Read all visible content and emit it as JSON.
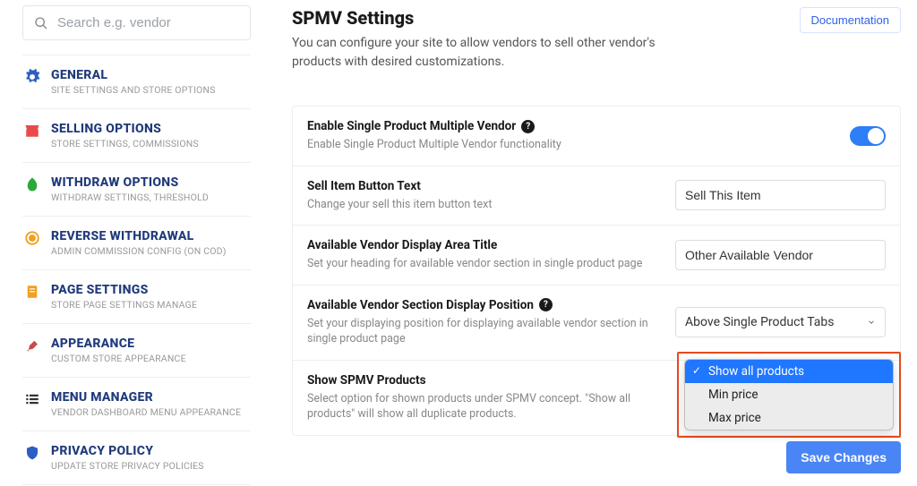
{
  "search": {
    "placeholder": "Search e.g. vendor"
  },
  "sidebar": {
    "items": [
      {
        "title": "GENERAL",
        "sub": "SITE SETTINGS AND STORE OPTIONS",
        "icon": "gear",
        "color": "#2b5fc1"
      },
      {
        "title": "SELLING OPTIONS",
        "sub": "STORE SETTINGS, COMMISSIONS",
        "icon": "store",
        "color": "#e94b4b"
      },
      {
        "title": "WITHDRAW OPTIONS",
        "sub": "WITHDRAW SETTINGS, THRESHOLD",
        "icon": "leaf",
        "color": "#2aa83a"
      },
      {
        "title": "REVERSE WITHDRAWAL",
        "sub": "ADMIN COMMISSION CONFIG (ON COD)",
        "icon": "coin",
        "color": "#f0a020"
      },
      {
        "title": "PAGE SETTINGS",
        "sub": "STORE PAGE SETTINGS MANAGE",
        "icon": "page",
        "color": "#f0a020"
      },
      {
        "title": "APPEARANCE",
        "sub": "CUSTOM STORE APPEARANCE",
        "icon": "palette",
        "color": "#c84b4b"
      },
      {
        "title": "MENU MANAGER",
        "sub": "VENDOR DASHBOARD MENU APPEARANCE",
        "icon": "menu",
        "color": "#333333"
      },
      {
        "title": "PRIVACY POLICY",
        "sub": "UPDATE STORE PRIVACY POLICIES",
        "icon": "shield",
        "color": "#2b5fc1"
      }
    ]
  },
  "header": {
    "title": "SPMV Settings",
    "desc": "You can configure your site to allow vendors to sell other vendor's products with desired customizations.",
    "doc_label": "Documentation"
  },
  "rows": {
    "enable": {
      "title": "Enable Single Product Multiple Vendor",
      "desc": "Enable Single Product Multiple Vendor functionality",
      "toggle": true
    },
    "button_text": {
      "title": "Sell Item Button Text",
      "desc": "Change your sell this item button text",
      "value": "Sell This Item"
    },
    "area_title": {
      "title": "Available Vendor Display Area Title",
      "desc": "Set your heading for available vendor section in single product page",
      "value": "Other Available Vendor"
    },
    "position": {
      "title": "Available Vendor Section Display Position",
      "desc": "Set your displaying position for displaying available vendor section in single product page",
      "value": "Above Single Product Tabs"
    },
    "show": {
      "title": "Show SPMV Products",
      "desc": "Select option for shown products under SPMV concept. \"Show all products\" will show all duplicate products."
    }
  },
  "dropdown": {
    "options": [
      "Show all products",
      "Min price",
      "Max price"
    ],
    "selected": "Show all products"
  },
  "actions": {
    "save": "Save Changes"
  }
}
